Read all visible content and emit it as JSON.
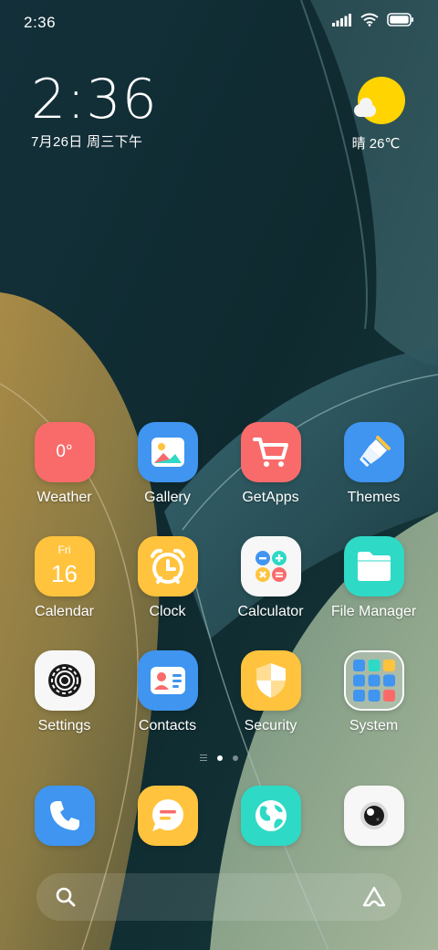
{
  "status_bar": {
    "time": "2:36"
  },
  "clock_widget": {
    "time": "2:36",
    "date": "7月26日 周三下午"
  },
  "weather_widget": {
    "condition_temp": "晴 26℃",
    "icon": "sunny-partly-cloudy-icon"
  },
  "apps": [
    {
      "label": "Weather",
      "icon": "weather-icon",
      "color": "#f96b6b",
      "tile_text": "0°"
    },
    {
      "label": "Gallery",
      "icon": "gallery-icon",
      "color": "#3f95f0"
    },
    {
      "label": "GetApps",
      "icon": "shopping-cart-icon",
      "color": "#f96b6b"
    },
    {
      "label": "Themes",
      "icon": "paintbrush-icon",
      "color": "#3f95f0"
    },
    {
      "label": "Calendar",
      "icon": "calendar-icon",
      "color": "#ffc33d",
      "tile_day": "Fri",
      "tile_date": "16"
    },
    {
      "label": "Clock",
      "icon": "alarm-clock-icon",
      "color": "#ffc33d"
    },
    {
      "label": "Calculator",
      "icon": "calculator-icon",
      "color": "#f7f7f7"
    },
    {
      "label": "File Manager",
      "icon": "folder-icon",
      "color": "#2ed9c6"
    },
    {
      "label": "Settings",
      "icon": "gear-icon",
      "color": "#f7f7f7"
    },
    {
      "label": "Contacts",
      "icon": "contact-card-icon",
      "color": "#3f95f0"
    },
    {
      "label": "Security",
      "icon": "shield-icon",
      "color": "#ffc33d"
    },
    {
      "label": "System",
      "icon": "folder-grid-icon",
      "color": "#ffffff"
    }
  ],
  "page_indicator": {
    "pages": 2,
    "active_page": 1
  },
  "dock": [
    {
      "name": "phone",
      "icon": "phone-icon",
      "color": "#3f95f0"
    },
    {
      "name": "messages",
      "icon": "message-bubble-icon",
      "color": "#ffc33d"
    },
    {
      "name": "browser",
      "icon": "globe-icon",
      "color": "#2ed9c6"
    },
    {
      "name": "camera",
      "icon": "camera-lens-icon",
      "color": "#f7f7f7"
    }
  ],
  "search_bar": {
    "search_icon": "search-icon",
    "assistant_icon": "assistant-icon"
  }
}
